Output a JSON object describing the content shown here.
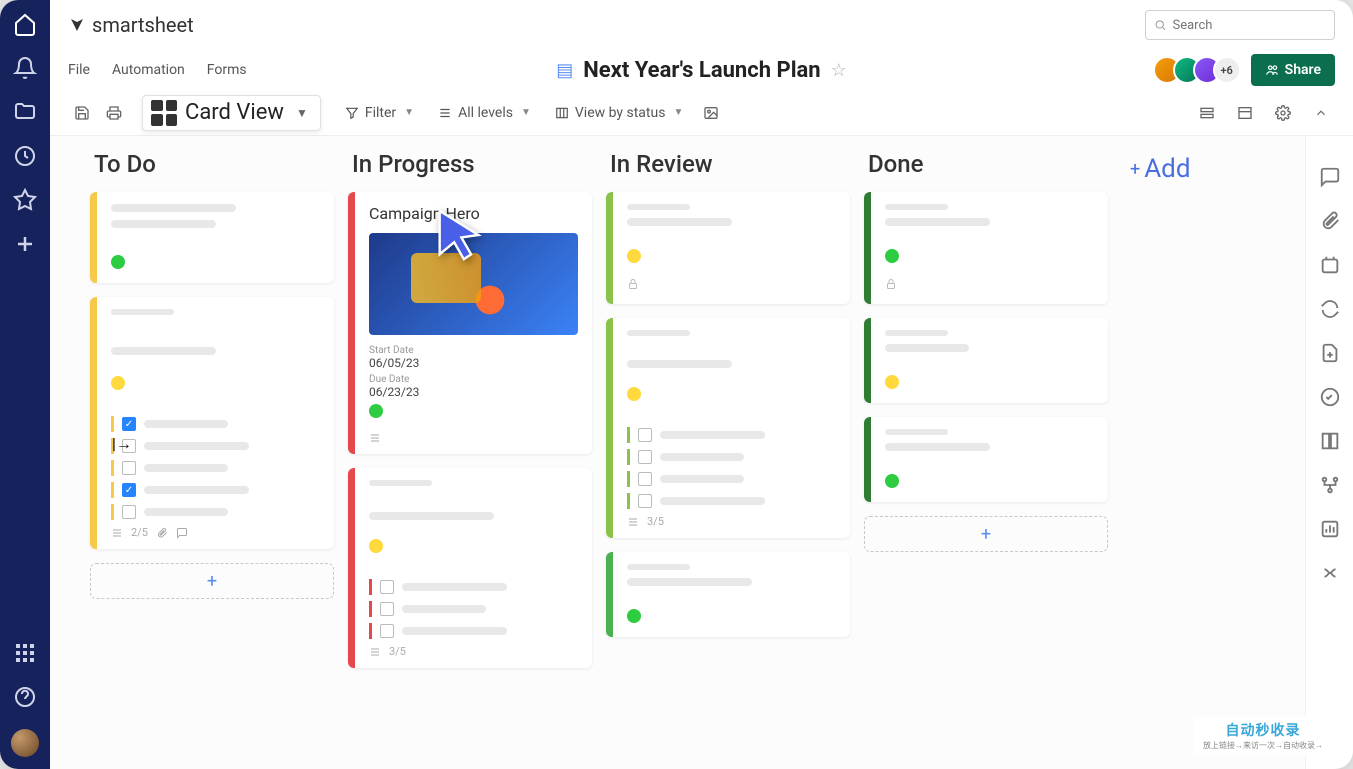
{
  "brand": {
    "name": "smartsheet"
  },
  "search": {
    "placeholder": "Search"
  },
  "menu": {
    "file": "File",
    "automation": "Automation",
    "forms": "Forms"
  },
  "doc": {
    "title": "Next Year's Launch Plan"
  },
  "collab": {
    "more_count": "+6",
    "share": "Share"
  },
  "view": {
    "label": "Card View"
  },
  "toolbar": {
    "filter": "Filter",
    "levels": "All levels",
    "view_by": "View by status"
  },
  "columns": {
    "todo": "To Do",
    "in_progress": "In Progress",
    "in_review": "In Review",
    "done": "Done",
    "add": "Add"
  },
  "hero_card": {
    "title": "Campaign Hero",
    "start_label": "Start Date",
    "start_value": "06/05/23",
    "due_label": "Due Date",
    "due_value": "06/23/23"
  },
  "meta": {
    "todo_count": "2/5",
    "inprog_count": "3/5",
    "inreview_count": "3/5"
  },
  "colors": {
    "stripe_yellow": "#f7c948",
    "stripe_red": "#e5484d",
    "stripe_green_light": "#8bc34a",
    "stripe_green": "#4caf50",
    "stripe_green_dark": "#2e7d32"
  },
  "watermark": {
    "big": "自动秒收录",
    "small": "放上链接→来访一次→自动收录→"
  }
}
